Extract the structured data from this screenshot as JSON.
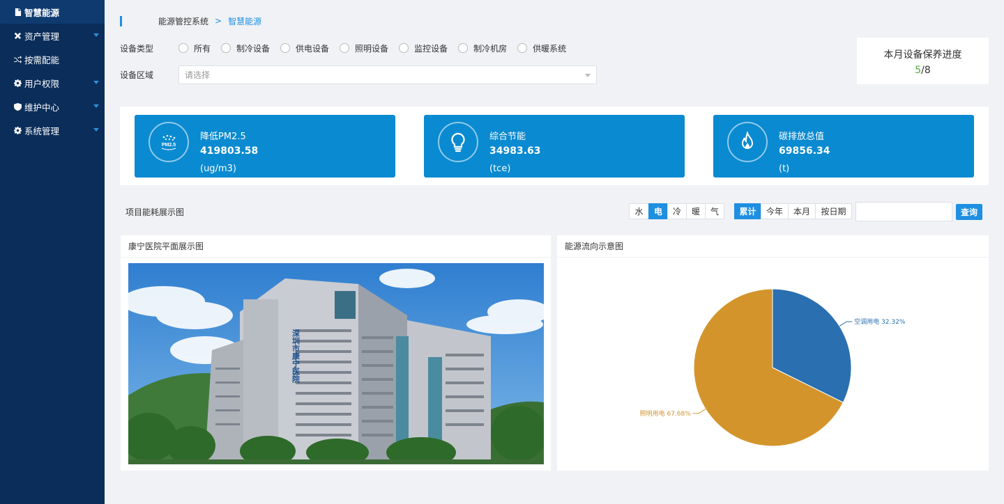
{
  "sidebar": {
    "items": [
      {
        "label": "智慧能源",
        "icon": "document-icon",
        "active": true
      },
      {
        "label": "资产管理",
        "icon": "tools-icon",
        "has_caret": true
      },
      {
        "label": "按需配能",
        "icon": "shuffle-icon"
      },
      {
        "label": "用户权限",
        "icon": "gear-icon",
        "has_caret": true
      },
      {
        "label": "维护中心",
        "icon": "shield-icon",
        "has_caret": true
      },
      {
        "label": "系统管理",
        "icon": "gear-icon",
        "has_caret": true
      }
    ]
  },
  "breadcrumb": {
    "home": "能源管控系统",
    "separator": ">",
    "current": "智慧能源"
  },
  "filters": {
    "device_type_label": "设备类型",
    "device_types": [
      "所有",
      "制冷设备",
      "供电设备",
      "照明设备",
      "监控设备",
      "制冷机房",
      "供暖系统"
    ],
    "area_label": "设备区域",
    "area_placeholder": "请选择"
  },
  "maintenance": {
    "title": "本月设备保养进度",
    "done": "5",
    "slash": "/",
    "total": "8"
  },
  "stats": [
    {
      "name": "降低PM2.5",
      "value": "419803.58",
      "unit": "(ug/m3)",
      "icon": "pm25-icon"
    },
    {
      "name": "综合节能",
      "value": "34983.63",
      "unit": "(tce)",
      "icon": "lightbulb-icon"
    },
    {
      "name": "碳排放总值",
      "value": "69856.34",
      "unit": "(t)",
      "icon": "flame-icon"
    }
  ],
  "energy_section": {
    "title": "项目能耗展示图",
    "energy_types": [
      "水",
      "电",
      "冷",
      "暖",
      "气"
    ],
    "energy_active": "电",
    "periods": [
      "累计",
      "今年",
      "本月",
      "按日期"
    ],
    "period_active": "累计",
    "date_value": "",
    "query_label": "查询"
  },
  "panels": {
    "floorplan_title": "康宁医院平面展示图",
    "photo_sign": "深圳市康宁医院",
    "flow_title": "能源流向示意图"
  },
  "colors": {
    "sidebar": "#0b2d5a",
    "accent": "#1e8fe1",
    "stat_card": "#0a8ad0",
    "pie_aircon": "#2a6fb0",
    "pie_light": "#d3952b"
  },
  "chart_data": {
    "type": "pie",
    "series": [
      {
        "name": "空调用电",
        "value": 32.32,
        "label": "空调用电 32.32%"
      },
      {
        "name": "照明用电",
        "value": 67.68,
        "label": "照明用电 67.68%"
      }
    ]
  }
}
